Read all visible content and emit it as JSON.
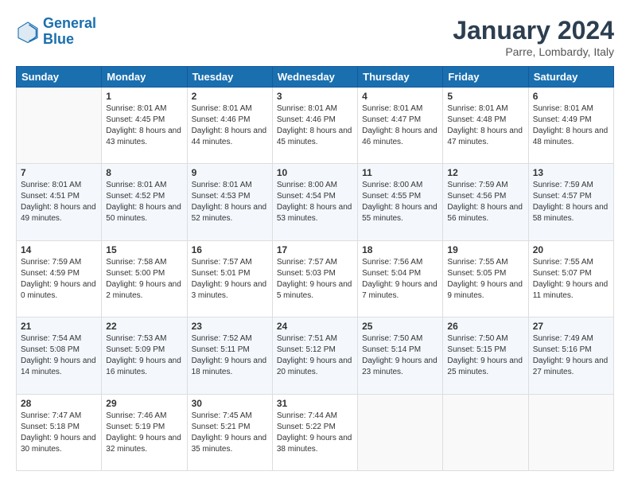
{
  "logo": {
    "text_general": "General",
    "text_blue": "Blue"
  },
  "header": {
    "month_year": "January 2024",
    "location": "Parre, Lombardy, Italy"
  },
  "days_of_week": [
    "Sunday",
    "Monday",
    "Tuesday",
    "Wednesday",
    "Thursday",
    "Friday",
    "Saturday"
  ],
  "weeks": [
    [
      {
        "day": "",
        "empty": true
      },
      {
        "day": "1",
        "sunrise": "8:01 AM",
        "sunset": "4:45 PM",
        "daylight": "8 hours and 43 minutes."
      },
      {
        "day": "2",
        "sunrise": "8:01 AM",
        "sunset": "4:46 PM",
        "daylight": "8 hours and 44 minutes."
      },
      {
        "day": "3",
        "sunrise": "8:01 AM",
        "sunset": "4:46 PM",
        "daylight": "8 hours and 45 minutes."
      },
      {
        "day": "4",
        "sunrise": "8:01 AM",
        "sunset": "4:47 PM",
        "daylight": "8 hours and 46 minutes."
      },
      {
        "day": "5",
        "sunrise": "8:01 AM",
        "sunset": "4:48 PM",
        "daylight": "8 hours and 47 minutes."
      },
      {
        "day": "6",
        "sunrise": "8:01 AM",
        "sunset": "4:49 PM",
        "daylight": "8 hours and 48 minutes."
      }
    ],
    [
      {
        "day": "7",
        "sunrise": "8:01 AM",
        "sunset": "4:51 PM",
        "daylight": "8 hours and 49 minutes."
      },
      {
        "day": "8",
        "sunrise": "8:01 AM",
        "sunset": "4:52 PM",
        "daylight": "8 hours and 50 minutes."
      },
      {
        "day": "9",
        "sunrise": "8:01 AM",
        "sunset": "4:53 PM",
        "daylight": "8 hours and 52 minutes."
      },
      {
        "day": "10",
        "sunrise": "8:00 AM",
        "sunset": "4:54 PM",
        "daylight": "8 hours and 53 minutes."
      },
      {
        "day": "11",
        "sunrise": "8:00 AM",
        "sunset": "4:55 PM",
        "daylight": "8 hours and 55 minutes."
      },
      {
        "day": "12",
        "sunrise": "7:59 AM",
        "sunset": "4:56 PM",
        "daylight": "8 hours and 56 minutes."
      },
      {
        "day": "13",
        "sunrise": "7:59 AM",
        "sunset": "4:57 PM",
        "daylight": "8 hours and 58 minutes."
      }
    ],
    [
      {
        "day": "14",
        "sunrise": "7:59 AM",
        "sunset": "4:59 PM",
        "daylight": "9 hours and 0 minutes."
      },
      {
        "day": "15",
        "sunrise": "7:58 AM",
        "sunset": "5:00 PM",
        "daylight": "9 hours and 2 minutes."
      },
      {
        "day": "16",
        "sunrise": "7:57 AM",
        "sunset": "5:01 PM",
        "daylight": "9 hours and 3 minutes."
      },
      {
        "day": "17",
        "sunrise": "7:57 AM",
        "sunset": "5:03 PM",
        "daylight": "9 hours and 5 minutes."
      },
      {
        "day": "18",
        "sunrise": "7:56 AM",
        "sunset": "5:04 PM",
        "daylight": "9 hours and 7 minutes."
      },
      {
        "day": "19",
        "sunrise": "7:55 AM",
        "sunset": "5:05 PM",
        "daylight": "9 hours and 9 minutes."
      },
      {
        "day": "20",
        "sunrise": "7:55 AM",
        "sunset": "5:07 PM",
        "daylight": "9 hours and 11 minutes."
      }
    ],
    [
      {
        "day": "21",
        "sunrise": "7:54 AM",
        "sunset": "5:08 PM",
        "daylight": "9 hours and 14 minutes."
      },
      {
        "day": "22",
        "sunrise": "7:53 AM",
        "sunset": "5:09 PM",
        "daylight": "9 hours and 16 minutes."
      },
      {
        "day": "23",
        "sunrise": "7:52 AM",
        "sunset": "5:11 PM",
        "daylight": "9 hours and 18 minutes."
      },
      {
        "day": "24",
        "sunrise": "7:51 AM",
        "sunset": "5:12 PM",
        "daylight": "9 hours and 20 minutes."
      },
      {
        "day": "25",
        "sunrise": "7:50 AM",
        "sunset": "5:14 PM",
        "daylight": "9 hours and 23 minutes."
      },
      {
        "day": "26",
        "sunrise": "7:50 AM",
        "sunset": "5:15 PM",
        "daylight": "9 hours and 25 minutes."
      },
      {
        "day": "27",
        "sunrise": "7:49 AM",
        "sunset": "5:16 PM",
        "daylight": "9 hours and 27 minutes."
      }
    ],
    [
      {
        "day": "28",
        "sunrise": "7:47 AM",
        "sunset": "5:18 PM",
        "daylight": "9 hours and 30 minutes."
      },
      {
        "day": "29",
        "sunrise": "7:46 AM",
        "sunset": "5:19 PM",
        "daylight": "9 hours and 32 minutes."
      },
      {
        "day": "30",
        "sunrise": "7:45 AM",
        "sunset": "5:21 PM",
        "daylight": "9 hours and 35 minutes."
      },
      {
        "day": "31",
        "sunrise": "7:44 AM",
        "sunset": "5:22 PM",
        "daylight": "9 hours and 38 minutes."
      },
      {
        "day": "",
        "empty": true
      },
      {
        "day": "",
        "empty": true
      },
      {
        "day": "",
        "empty": true
      }
    ]
  ]
}
